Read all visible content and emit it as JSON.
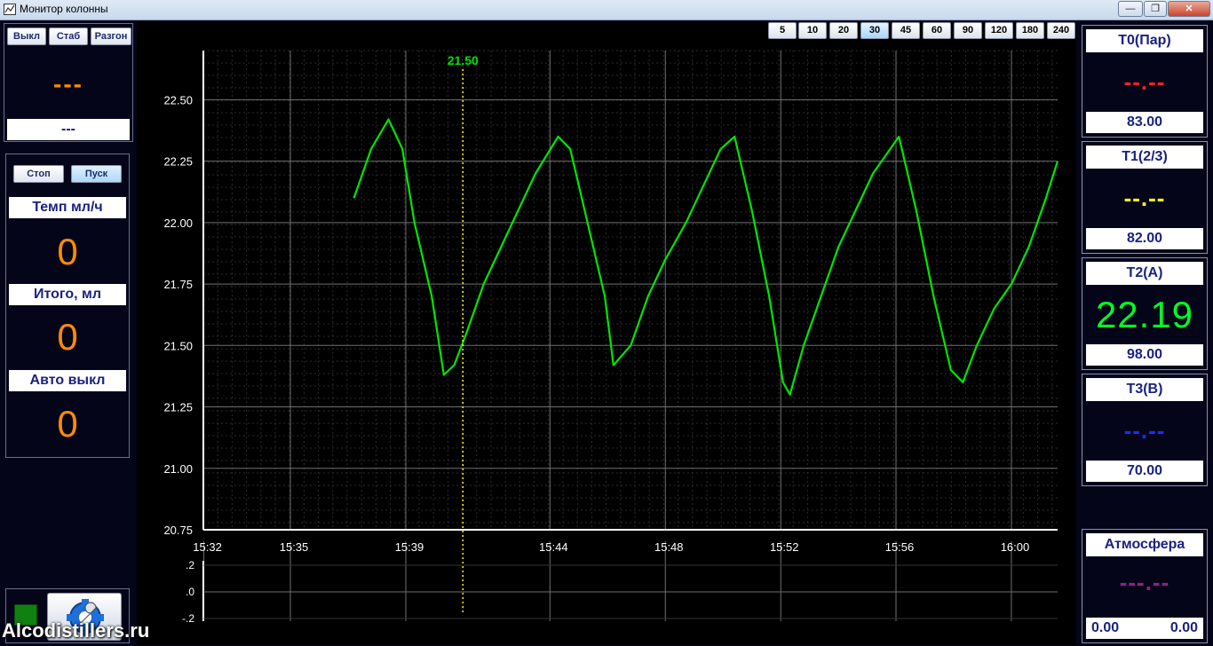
{
  "window": {
    "title": "Монитор колонны",
    "minimize": "—",
    "maximize": "❐",
    "close": "✕"
  },
  "left_panel": {
    "mode_buttons": [
      "Выкл",
      "Стаб",
      "Разгон"
    ],
    "mode_value": "---",
    "mode_status": "---",
    "stop_label": "Стоп",
    "start_label": "Пуск",
    "rate_label": "Темп мл/ч",
    "rate_value": "0",
    "total_label": "Итого, мл",
    "total_value": "0",
    "autooff_label": "Авто выкл",
    "autooff_value": "0"
  },
  "time_buttons": [
    "5",
    "10",
    "20",
    "30",
    "45",
    "60",
    "90",
    "120",
    "180",
    "240"
  ],
  "time_active": "30",
  "chart_data": {
    "type": "line",
    "cursor_label": "21.50",
    "cursor_x": 15.683,
    "x_ticks": [
      "15:32",
      "15:35",
      "15:39",
      "15:44",
      "15:48",
      "15:52",
      "15:56",
      "16:00"
    ],
    "x_tick_values": [
      15.5333,
      15.5833,
      15.65,
      15.7333,
      15.8,
      15.8667,
      15.9333,
      16.0
    ],
    "y_ticks": [
      "22.50",
      "22.25",
      "22.00",
      "21.75",
      "21.50",
      "21.25",
      "21.00",
      "20.75"
    ],
    "y_tick_values": [
      22.5,
      22.25,
      22.0,
      21.75,
      21.5,
      21.25,
      21.0,
      20.75
    ],
    "xlim": [
      15.533,
      16.0267
    ],
    "ylim": [
      20.75,
      22.7
    ],
    "lower_ticks": [
      ".2",
      ".0",
      "-.2"
    ],
    "series": [
      {
        "color": "#00e600",
        "x": [
          15.62,
          15.625,
          15.63,
          15.64,
          15.648,
          15.655,
          15.665,
          15.672,
          15.678,
          15.685,
          15.695,
          15.705,
          15.715,
          15.725,
          15.738,
          15.745,
          15.755,
          15.765,
          15.77,
          15.78,
          15.79,
          15.8,
          15.812,
          15.822,
          15.832,
          15.84,
          15.85,
          15.86,
          15.868,
          15.872,
          15.88,
          15.89,
          15.9,
          15.91,
          15.92,
          15.93,
          15.935,
          15.945,
          15.955,
          15.965,
          15.972,
          15.98,
          15.99,
          16.0,
          16.01,
          16.02,
          16.0267
        ],
        "y": [
          22.1,
          22.2,
          22.3,
          22.42,
          22.3,
          22.0,
          21.7,
          21.38,
          21.42,
          21.55,
          21.75,
          21.9,
          22.05,
          22.2,
          22.35,
          22.3,
          22.0,
          21.7,
          21.42,
          21.5,
          21.7,
          21.85,
          22.0,
          22.15,
          22.3,
          22.35,
          22.05,
          21.7,
          21.35,
          21.3,
          21.5,
          21.7,
          21.9,
          22.05,
          22.2,
          22.3,
          22.35,
          22.05,
          21.7,
          21.4,
          21.35,
          21.5,
          21.65,
          21.75,
          21.9,
          22.1,
          22.25
        ]
      }
    ]
  },
  "sensors": [
    {
      "name": "T0(Пар)",
      "value": "--.--",
      "color": "#ff2020",
      "setpoint": "83.00"
    },
    {
      "name": "T1(2/3)",
      "value": "--.--",
      "color": "#ffff00",
      "setpoint": "82.00"
    },
    {
      "name": "T2(A)",
      "value": "22.19",
      "color": "#00ff22",
      "setpoint": "98.00"
    },
    {
      "name": "T3(B)",
      "value": "--.--",
      "color": "#1a2cff",
      "setpoint": "70.00"
    }
  ],
  "atmosphere": {
    "name": "Атмосфера",
    "value": "---.--",
    "color": "#9b1c8a",
    "left": "0.00",
    "right": "0.00"
  },
  "watermark": "Alcodistillers.ru",
  "icons": {
    "app": "chart-icon",
    "settings": "settings-wrench-icon",
    "status": "status-indicator-icon"
  }
}
